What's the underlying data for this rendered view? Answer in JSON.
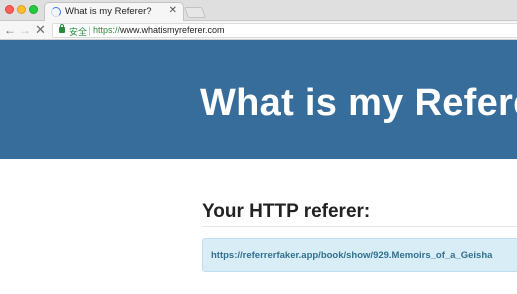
{
  "browser": {
    "tab": {
      "title": "What is my Referer?",
      "close_glyph": "✕",
      "loading_icon": "loading-spinner-icon"
    },
    "toolbar": {
      "back_glyph": "←",
      "forward_glyph": "→",
      "stop_glyph": "✕",
      "security_label": "安全",
      "url_scheme": "https://",
      "url_rest": "www.whatismyreferer.com"
    }
  },
  "page": {
    "hero_title": "What is my Referer?",
    "heading": "Your HTTP referer:",
    "referer_value": "https://referrerfaker.app/book/show/929.Memoirs_of_a_Geisha"
  },
  "colors": {
    "hero_bg": "#376d9b",
    "secure_green": "#2a8a3e",
    "referer_box_bg": "#d9edf7",
    "referer_text": "#31708f"
  }
}
